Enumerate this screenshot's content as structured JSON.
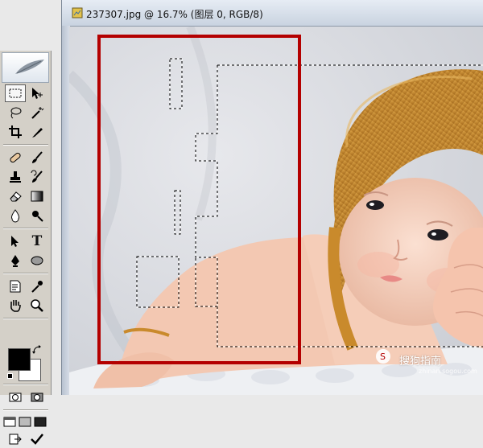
{
  "document": {
    "title": "237307.jpg @ 16.7% (图层 0, RGB/8)"
  },
  "toolbox": {
    "tools": [
      {
        "name": "rectangular-marquee",
        "active": true
      },
      {
        "name": "move"
      },
      {
        "name": "lasso"
      },
      {
        "name": "magic-wand"
      },
      {
        "name": "crop"
      },
      {
        "name": "slice"
      },
      {
        "name": "healing-brush"
      },
      {
        "name": "brush"
      },
      {
        "name": "clone-stamp"
      },
      {
        "name": "history-brush"
      },
      {
        "name": "eraser"
      },
      {
        "name": "gradient"
      },
      {
        "name": "blur"
      },
      {
        "name": "dodge"
      },
      {
        "name": "path-selection"
      },
      {
        "name": "type"
      },
      {
        "name": "pen"
      },
      {
        "name": "ellipse-shape"
      },
      {
        "name": "notes"
      },
      {
        "name": "eyedropper"
      },
      {
        "name": "hand"
      },
      {
        "name": "zoom"
      }
    ],
    "type_glyph": "T",
    "foreground_color": "#000000",
    "background_color": "#ffffff"
  },
  "watermark": {
    "text": "搜狗指南",
    "sub": "zhinan.sogou.com"
  },
  "colors": {
    "highlight_box": "#b40000",
    "hat": "#c98a2c",
    "skin": "#f2c9b4",
    "background_photo": "#d6d9df"
  }
}
